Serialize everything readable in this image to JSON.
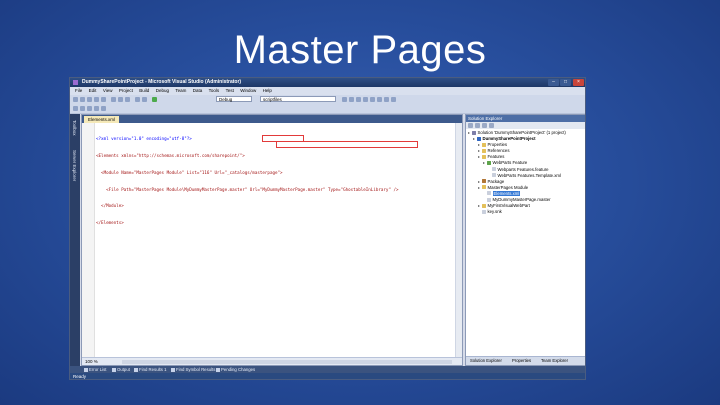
{
  "slide": {
    "title": "Master Pages"
  },
  "window": {
    "title": "DummySharePointProject - Microsoft Visual Studio (Administrator)",
    "controls": {
      "minimize": "–",
      "maximize": "□",
      "close": "×"
    }
  },
  "menu": [
    "File",
    "Edit",
    "View",
    "Project",
    "Build",
    "Debug",
    "Team",
    "Data",
    "Tools",
    "Test",
    "Window",
    "Help"
  ],
  "toolbar": {
    "config": "Debug",
    "search": "scriptfiles"
  },
  "left_tabs": [
    "Toolbox",
    "Server Explorer"
  ],
  "editor": {
    "tab": "Elements.xml",
    "zoom": "100 %",
    "lines": [
      "<?xml version=\"1.0\" encoding=\"utf-8\"?>",
      "<Elements xmlns=\"http://schemas.microsoft.com/sharepoint/\">",
      "  <Module Name=\"MasterPages Module\" List=\"116\" Url=\"_catalogs/masterpage\">",
      "    <File Path=\"MasterPages Module\\MyDummyMasterPage.master\" Url=\"MyDummyMasterPage.master\" Type=\"GhostableInLibrary\" />",
      "  </Module>",
      "</Elements>"
    ]
  },
  "solution_explorer": {
    "title": "Solution Explorer",
    "tree": [
      {
        "label": "Solution 'DummySharePointProject' (1 project)",
        "icon": "solution-icon",
        "depth": 0
      },
      {
        "label": "DummySharePointProject",
        "icon": "project-icon",
        "depth": 1,
        "bold": true
      },
      {
        "label": "Properties",
        "icon": "folder-icon",
        "depth": 2
      },
      {
        "label": "References",
        "icon": "folder-icon",
        "depth": 2
      },
      {
        "label": "Features",
        "icon": "folder-icon",
        "depth": 2
      },
      {
        "label": "WebParts Feature",
        "icon": "feature-icon",
        "depth": 3
      },
      {
        "label": "Webparts Features.feature",
        "icon": "file-icon",
        "depth": 4
      },
      {
        "label": "WebParts Features.Template.xml",
        "icon": "file-icon",
        "depth": 4
      },
      {
        "label": "Package",
        "icon": "package-icon",
        "depth": 2
      },
      {
        "label": "MasterPages Module",
        "icon": "folder-icon",
        "depth": 2
      },
      {
        "label": "Elements.xml",
        "icon": "file-icon",
        "depth": 3,
        "selected": true
      },
      {
        "label": "MyDummyMasterPage.master",
        "icon": "file-icon",
        "depth": 3
      },
      {
        "label": "MyFirstVisualWebPart",
        "icon": "folder-icon",
        "depth": 2
      },
      {
        "label": "key.snk",
        "icon": "file-icon",
        "depth": 2
      }
    ],
    "tabs": [
      "Solution Explorer",
      "Properties",
      "Team Explorer"
    ]
  },
  "bottom_tabs": [
    "Error List",
    "Output",
    "Find Results 1",
    "Find Symbol Results",
    "Pending Changes"
  ],
  "status": "Ready"
}
